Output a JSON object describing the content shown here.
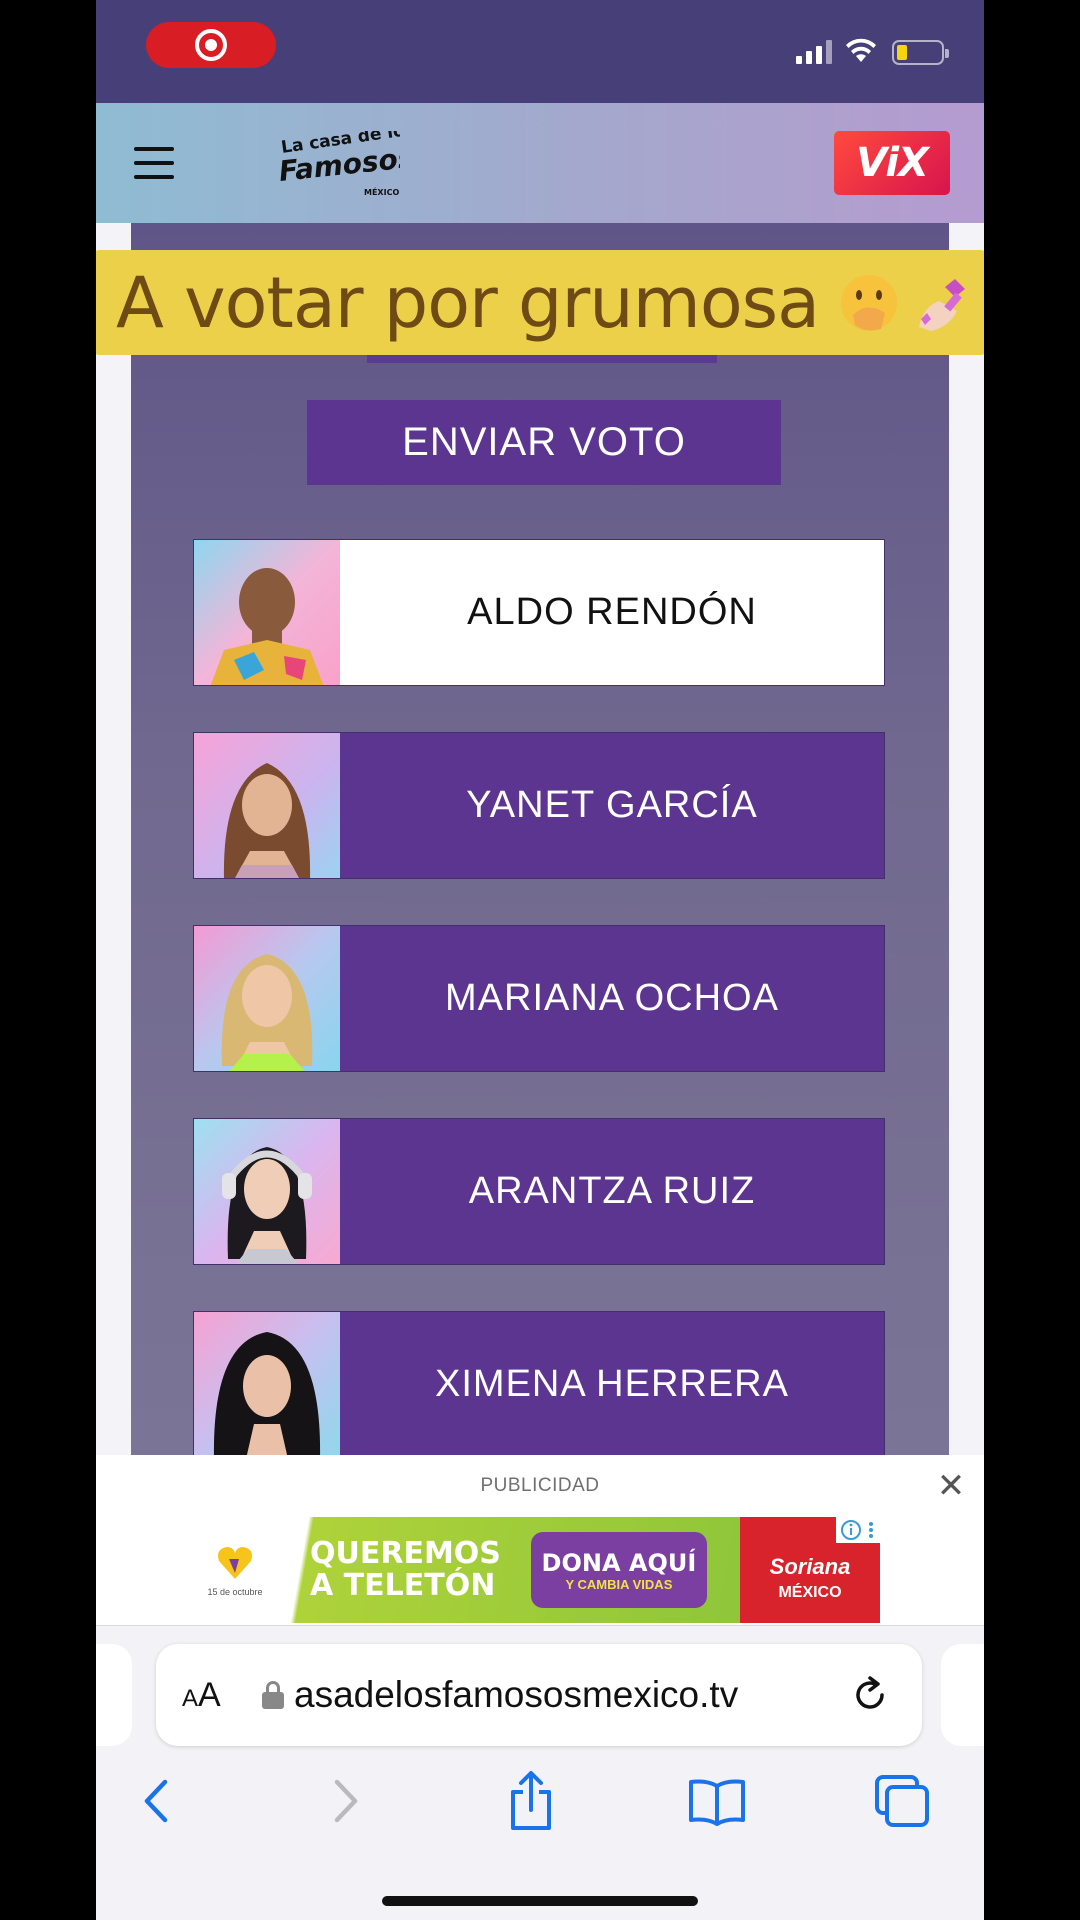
{
  "status_bar": {
    "recording": true
  },
  "site_header": {
    "brand_logo_text_1": "La casa de los",
    "brand_logo_text_2": "Famosos",
    "brand_logo_text_3": "MÉXICO",
    "partner_logo": "ViX"
  },
  "caption": {
    "text": "A votar por grumosa",
    "emojis": [
      "face-with-hand-over-mouth",
      "nail-polish"
    ]
  },
  "vote": {
    "submit_label": "ENVIAR VOTO",
    "contestants": [
      {
        "name": "ALDO RENDÓN",
        "selected": true
      },
      {
        "name": "YANET GARCÍA",
        "selected": false
      },
      {
        "name": "MARIANA OCHOA",
        "selected": false
      },
      {
        "name": "ARANTZA RUIZ",
        "selected": false
      },
      {
        "name": "XIMENA HERRERA",
        "selected": false
      }
    ]
  },
  "ad": {
    "label": "PUBLICIDAD",
    "close_label": "✕",
    "date_text": "15 de octubre",
    "headline_1": "QUEREMOS",
    "headline_2": "A TELETÓN",
    "cta_main": "DONA AQUÍ",
    "cta_sub": "Y CAMBIA VIDAS",
    "brand": "Soriana",
    "brand_sub": "MÉXICO"
  },
  "browser": {
    "reader_label_small": "A",
    "reader_label_large": "A",
    "url": "asadelosfamososmexico.tv"
  },
  "colors": {
    "status_bar": "#463f78",
    "vote_button": "#5c3591",
    "caption_bg": "#ecd04a",
    "caption_text": "#6e4a14",
    "safari_blue": "#1a73e8"
  }
}
